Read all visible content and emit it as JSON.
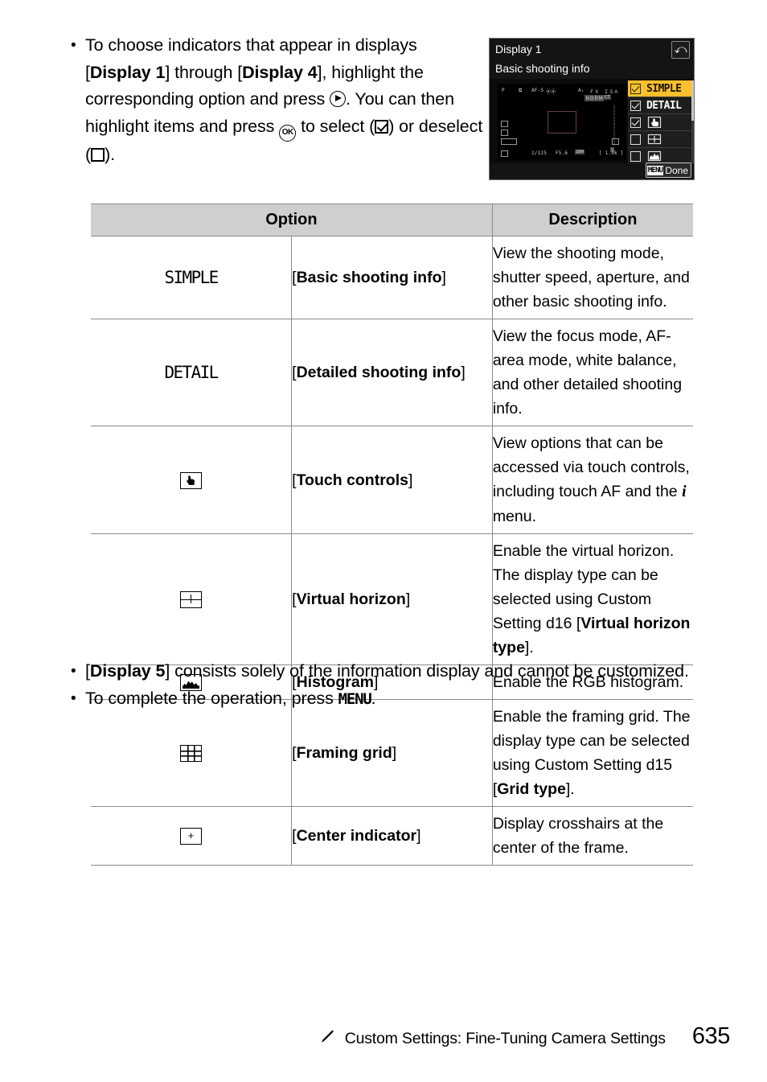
{
  "intro": {
    "bullet": "•",
    "line1_a": "To choose indicators that appear in displays [",
    "display1": "Display 1",
    "line1_b": "] through [",
    "display4": "Display 4",
    "line1_c": "], highlight the corresponding option and press ",
    "line1_d": ". You can then highlight items and press ",
    "line1_e": " to select (",
    "line1_f": ") or deselect (",
    "line1_g": ").",
    "multi_selector_icon": "multi-selector-right-icon",
    "ok_button_icon": "ok-button-icon",
    "ok_label": "OK",
    "checkbox_checked_icon": "checkbox-checked-icon",
    "checkbox_empty_icon": "checkbox-empty-icon"
  },
  "camera_screen": {
    "title": "Display 1",
    "subtitle": "Basic shooting info",
    "back_icon": "↰",
    "back_glyph": "⤺",
    "menu_key": "MENU",
    "done_label": "Done",
    "live_view": {
      "mode": "P",
      "release_mode": "⧉",
      "focus_mode": "AF-S",
      "af_area": "⦿⦿",
      "wb": "A₁",
      "image_area": "ＦＸ",
      "quality_1": "ＩＳＡ",
      "quality_2": "ＮＯＲＭ",
      "card": "CT",
      "shutter_speed": "125",
      "shutter_prefix": "1/",
      "aperture": "F5.6",
      "iso_label": "ISO",
      "iso_value": "100",
      "frames_remaining": "[ 1.0k ]"
    },
    "items": [
      {
        "label": "SIMPLE",
        "icon": null,
        "checked": true,
        "highlighted": true
      },
      {
        "label": "DETAIL",
        "icon": null,
        "checked": true,
        "highlighted": false
      },
      {
        "label": "",
        "icon": "touch-controls-icon",
        "checked": true,
        "highlighted": false
      },
      {
        "label": "",
        "icon": "virtual-horizon-icon",
        "checked": false,
        "highlighted": false
      },
      {
        "label": "",
        "icon": "histogram-icon",
        "checked": false,
        "highlighted": false
      },
      {
        "label": "",
        "icon": "framing-grid-icon",
        "checked": false,
        "highlighted": false
      }
    ],
    "colors": {
      "highlight": "#fbc02d",
      "background": "#141414",
      "text": "#ffffff"
    }
  },
  "table": {
    "headers": {
      "option": "Option",
      "description": "Description"
    },
    "rows": [
      {
        "icon_type": "text",
        "icon_text": "SIMPLE",
        "icon_name": "simple-icon",
        "name_open": "[",
        "name": "Basic shooting info",
        "name_close": "]",
        "desc_1": "View the shooting mode, shutter speed, aperture, and other basic shooting info.",
        "desc_bold": "",
        "desc_2": ""
      },
      {
        "icon_type": "text",
        "icon_text": "DETAIL",
        "icon_name": "detail-icon",
        "name_open": "[",
        "name": "Detailed shooting info",
        "name_close": "]",
        "desc_1": "View the focus mode, AF-area mode, white balance, and other detailed shooting info.",
        "desc_bold": "",
        "desc_2": ""
      },
      {
        "icon_type": "glyph",
        "icon_class": "touch",
        "icon_name": "touch-controls-icon",
        "name_open": "[",
        "name": "Touch controls",
        "name_close": "]",
        "desc_1": "View options that can be accessed via touch controls, including touch AF and the ",
        "desc_italic_i": "i",
        "desc_2": " menu."
      },
      {
        "icon_type": "glyph",
        "icon_class": "horizon",
        "icon_name": "virtual-horizon-icon",
        "name_open": "[",
        "name": "Virtual horizon",
        "name_close": "]",
        "desc_1": "Enable the virtual horizon. The display type can be selected using Custom Setting d16 [",
        "desc_bold": "Virtual horizon type",
        "desc_2": "]."
      },
      {
        "icon_type": "glyph",
        "icon_class": "hist",
        "icon_name": "histogram-icon",
        "name_open": "[",
        "name": "Histogram",
        "name_close": "]",
        "desc_1": "Enable the RGB histogram.",
        "desc_bold": "",
        "desc_2": ""
      },
      {
        "icon_type": "glyph",
        "icon_class": "grid",
        "icon_name": "framing-grid-icon",
        "name_open": "[",
        "name": "Framing grid",
        "name_close": "]",
        "desc_1": "Enable the framing grid. The display type can be selected using Custom Setting d15 [",
        "desc_bold": "Grid type",
        "desc_2": "]."
      },
      {
        "icon_type": "glyph",
        "icon_class": "center",
        "icon_name": "center-indicator-icon",
        "name_open": "[",
        "name": "Center indicator",
        "name_close": "]",
        "desc_1": "Display crosshairs at the center of the frame.",
        "desc_bold": "",
        "desc_2": ""
      }
    ]
  },
  "outro": {
    "bullet": "•",
    "b1_a": "[",
    "b1_bold": "Display 5",
    "b1_b": "] consists solely of the information display and cannot be customized.",
    "b2_a": "To complete the operation, press ",
    "b2_key": "MENU",
    "b2_b": "."
  },
  "footer": {
    "icon": "pencil-icon",
    "title": "Custom Settings: Fine-Tuning Camera Settings",
    "page": "635"
  }
}
